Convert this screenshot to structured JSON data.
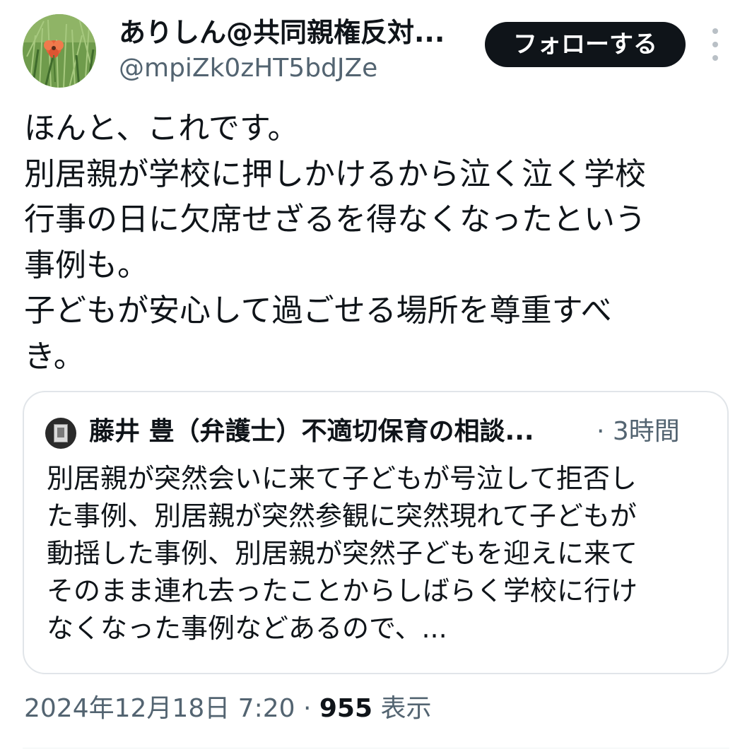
{
  "author": {
    "display_name": "ありしん@共同親権反対...",
    "handle": "@mpiZk0zHT5bdJZe",
    "avatar_icon": "flower-avatar"
  },
  "follow_button_label": "フォローする",
  "more_icon": "more-vertical-icon",
  "tweet_lines": [
    "ほんと、これです。",
    "別居親が学校に押しかけるから泣く泣く学校",
    "行事の日に欠席せざるを得なくなったという",
    "事例も。",
    "子どもが安心して過ごせる場所を尊重すべ",
    "き。"
  ],
  "quote": {
    "author_name": "藤井 豊（弁護士）不適切保育の相談...",
    "time": "· 3時間",
    "lines": [
      "別居親が突然会いに来て子どもが号泣して拒否し",
      "た事例、別居親が突然参観に突然現れて子どもが",
      "動揺した事例、別居親が突然子どもを迎えに来て",
      "そのまま連れ去ったことからしばらく学校に行け",
      "なくなった事例などあるので、..."
    ]
  },
  "meta": {
    "timestamp": "2024年12月18日 7:20",
    "separator": " · ",
    "views_count": "955",
    "views_label": " 表示"
  },
  "colors": {
    "text_primary": "#0f1419",
    "text_secondary": "#536471",
    "border": "#e1e5e9",
    "follow_bg": "#0f1419"
  }
}
